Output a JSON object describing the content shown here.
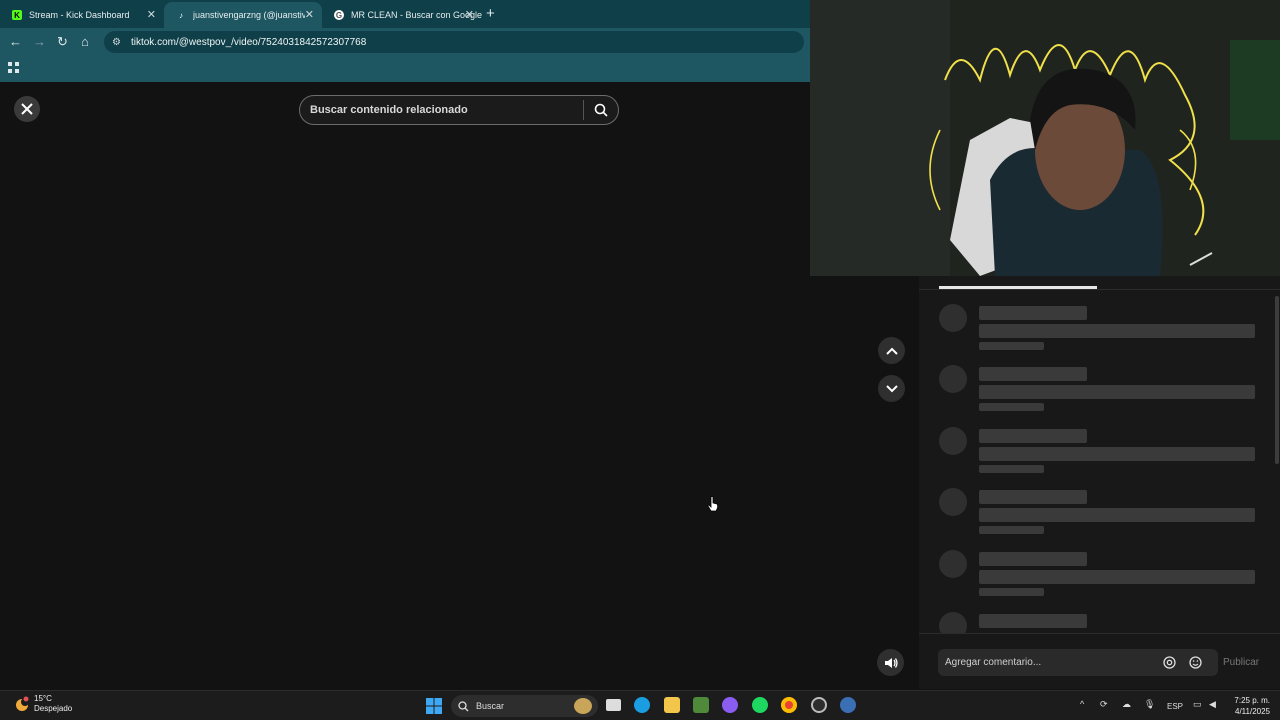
{
  "browser": {
    "tabs": [
      {
        "title": "Stream - Kick Dashboard",
        "favicon": "kick-icon",
        "favicon_color": "#53fc18",
        "active": false
      },
      {
        "title": "juanstivengarzng (@juanstiven",
        "favicon": "tiktok-icon",
        "favicon_color": "#ffffff",
        "active": true
      },
      {
        "title": "MR CLEAN - Buscar con Google",
        "favicon": "google-icon",
        "favicon_color": "#ffffff",
        "active": false
      }
    ],
    "new_tab": "+",
    "close_glyph": "✕",
    "url": "tiktok.com/@westpov_/video/7524031842572307768"
  },
  "tiktok": {
    "search_placeholder": "Buscar contenido relacionado",
    "comments": {
      "placeholder": "Agregar comentario...",
      "publish_label": "Publicar"
    }
  },
  "taskbar": {
    "weather": {
      "temp": "15°C",
      "condition": "Despejado"
    },
    "search_label": "Buscar",
    "language": "ESP",
    "time": "7:25 p. m.",
    "date": "4/11/2025",
    "chevron": "^"
  },
  "colors": {
    "chrome_dark": "#0f3f48",
    "chrome_light": "#1e5661",
    "page_bg": "#121212",
    "panel_bg": "#181818"
  }
}
